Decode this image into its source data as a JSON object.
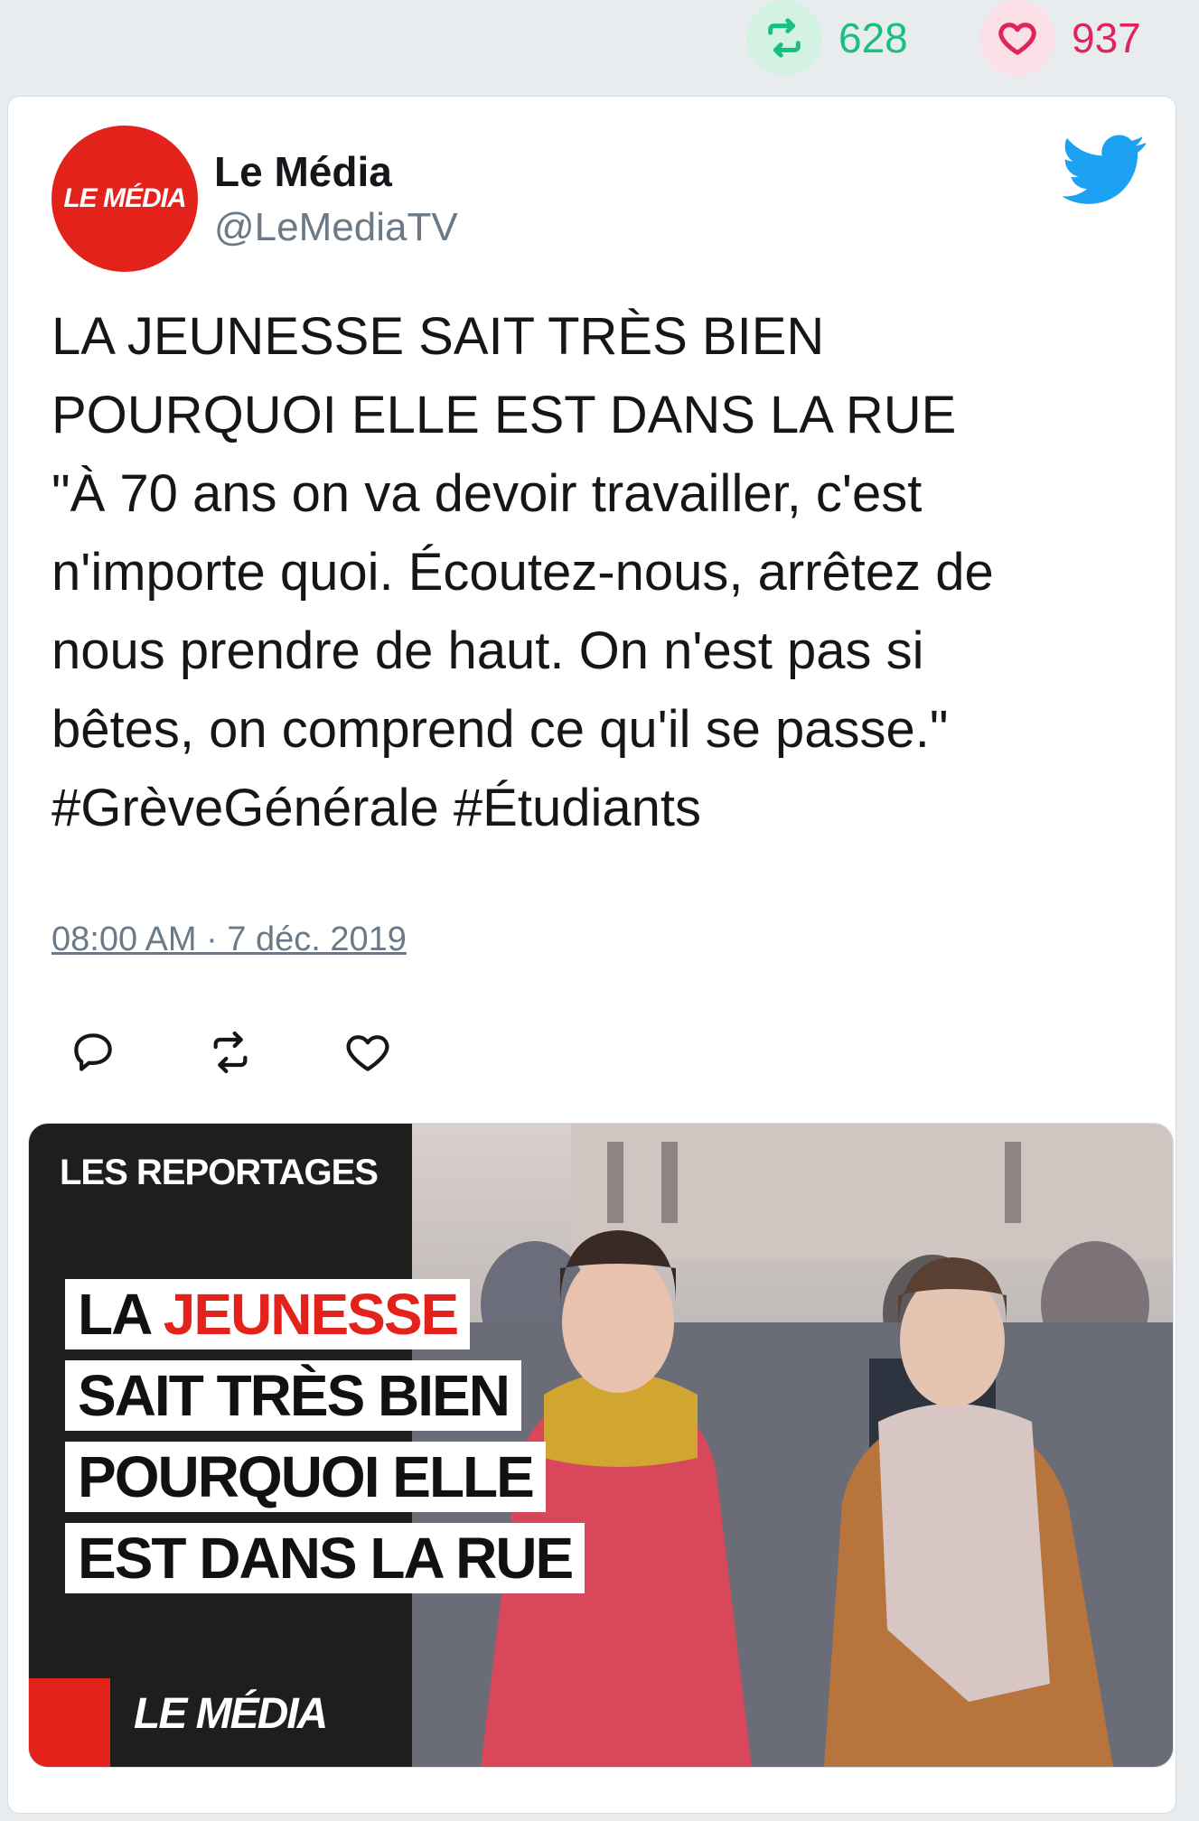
{
  "stats": {
    "retweets": "628",
    "likes": "937"
  },
  "user": {
    "name": "Le Média",
    "handle": "@LeMediaTV",
    "avatar_text": "LE MÉDIA"
  },
  "tweet": {
    "text": "LA JEUNESSE SAIT TRÈS BIEN\nPOURQUOI ELLE EST DANS LA RUE\n\"À 70 ans on va devoir travailler, c'est\nn'importe quoi. Écoutez-nous, arrêtez de\nnous prendre de haut. On n'est pas si\nbêtes, on comprend ce qu'il se passe.\"\n#GrèveGénérale #Étudiants",
    "timestamp": "08:00 AM · 7 déc. 2019"
  },
  "actions": {
    "reply_icon": "reply-icon",
    "retweet_icon": "retweet-icon",
    "like_icon": "heart-icon"
  },
  "media": {
    "label": "LES REPORTAGES",
    "headline_1a": "LA ",
    "headline_1b": "JEUNESSE",
    "headline_2": "SAIT TRÈS BIEN",
    "headline_3": "POURQUOI ELLE",
    "headline_4": "EST DANS LA RUE",
    "logo": "LE MÉDIA"
  },
  "colors": {
    "brand_red": "#e3231b",
    "retweet_green": "#19bf7d",
    "like_pink": "#e0245e",
    "twitter_blue": "#1da1f2"
  }
}
